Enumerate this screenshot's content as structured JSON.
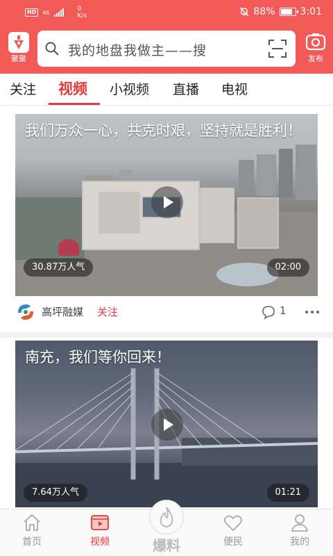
{
  "status_bar": {
    "hd": "HD",
    "signal": "46",
    "speed_value": "0",
    "speed_unit": "K/s",
    "battery": "88%",
    "battery_level": 0.88,
    "time": "3:01"
  },
  "header": {
    "logo_label": "聚聚",
    "search_placeholder": "我的地盘我做主——搜",
    "publish_label": "发布"
  },
  "tabs": [
    {
      "label": "关注",
      "active": false
    },
    {
      "label": "视频",
      "active": true
    },
    {
      "label": "小视频",
      "active": false
    },
    {
      "label": "直播",
      "active": false
    },
    {
      "label": "电视",
      "active": false
    }
  ],
  "feed": [
    {
      "title": "我们万众一心，共克时艰，坚持就是胜利！",
      "views": "30.87万人气",
      "duration": "02:00",
      "source": "高坪融媒",
      "follow": "关注",
      "comments": "1"
    },
    {
      "title": "南充，我们等你回来！",
      "views": "7.64万人气",
      "duration": "01:21"
    }
  ],
  "bottom_nav": [
    {
      "label": "首页",
      "icon": "home-icon"
    },
    {
      "label": "视频",
      "icon": "video-icon",
      "active": true
    },
    {
      "label": "爆料",
      "icon": "fire-icon"
    },
    {
      "label": "便民",
      "icon": "heart-icon"
    },
    {
      "label": "我的",
      "icon": "user-icon"
    }
  ],
  "colors": {
    "brand": "#f25a57",
    "accent": "#e6383b"
  }
}
